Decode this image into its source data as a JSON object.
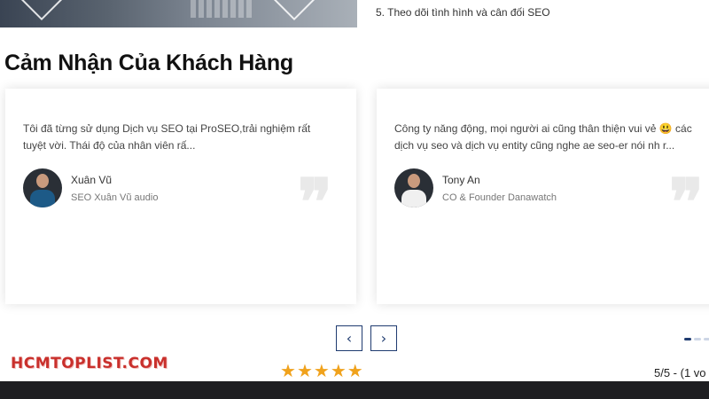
{
  "top": {
    "step_text": "5. Theo dõi tình hình và cân đối SEO"
  },
  "section": {
    "title": "Cảm Nhận Của Khách Hàng"
  },
  "testimonials": [
    {
      "text": "Tôi đã từng sử dụng Dịch vụ SEO tại ProSEO,trải nghiệm rất tuyệt vời. Thái độ của nhân viên rấ...",
      "name": "Xuân Vũ",
      "role": "SEO Xuân Vũ audio"
    },
    {
      "text": "Công ty năng động, mọi người ai cũng thân thiện vui vẻ 😃 các dịch vụ seo và dịch vụ entity cũng nghe ae seo-er nói nh r...",
      "name": "Tony An",
      "role": "CO & Founder Danawatch"
    }
  ],
  "carousel": {
    "prev_icon": "‹",
    "next_icon": "›"
  },
  "footer": {
    "logo_text": "HCMTOPLIST.COM",
    "stars": "★★★★★",
    "rating_text": "5/5 - (1 vo"
  },
  "colors": {
    "accent": "#1f3b70",
    "star": "#f0a21c",
    "logo": "#c9302c"
  }
}
